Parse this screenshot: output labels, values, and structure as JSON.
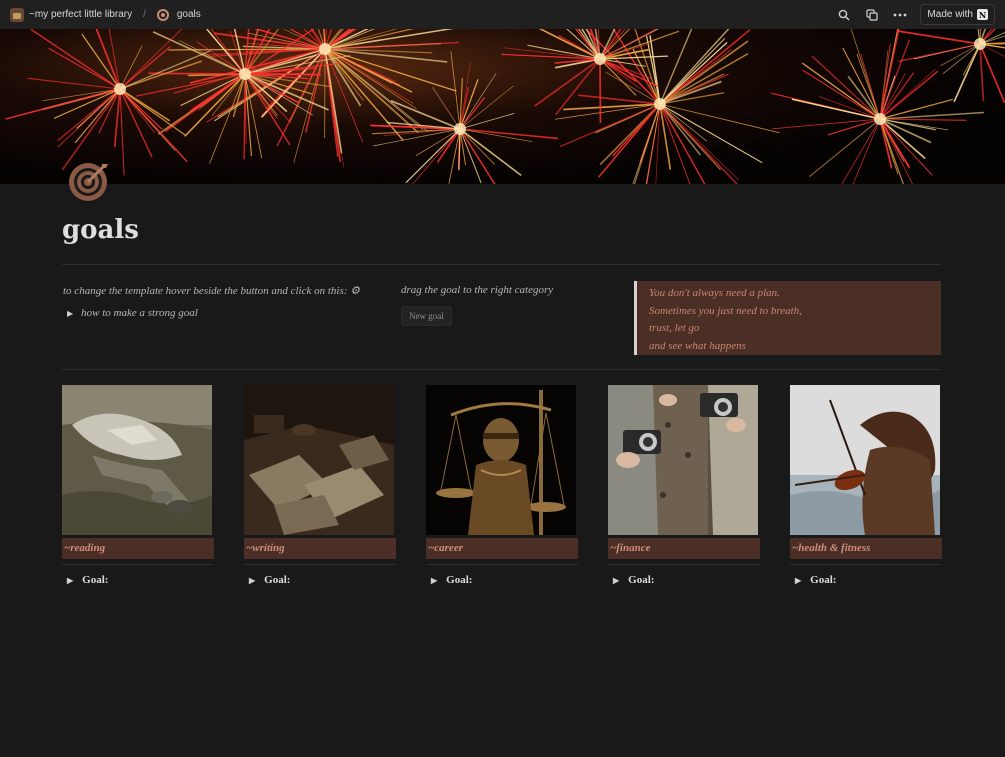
{
  "topbar": {
    "workspace": "~my perfect little library",
    "separator": "/",
    "page": "goals",
    "made_with": "Made with",
    "icons": [
      "search-icon",
      "duplicate-icon",
      "more-icon",
      "notion-logo-icon"
    ]
  },
  "page": {
    "title": "goals",
    "icon": "target-icon"
  },
  "instructions": {
    "template_hint": "to change the template hover beside the button and click on this: ⚙",
    "toggle_strong_goal": "how to make a strong goal",
    "drag_hint": "drag the goal to the right category",
    "new_goal_button": "New goal"
  },
  "quote": {
    "lines": [
      "You don't always need a plan.",
      "Sometimes you just need to breath,",
      "trust, let go",
      "and see what happens"
    ]
  },
  "categories": [
    {
      "label": "~reading",
      "goal": "Goal:"
    },
    {
      "label": "~writing",
      "goal": "Goal:"
    },
    {
      "label": "~career",
      "goal": "Goal:"
    },
    {
      "label": "~finance",
      "goal": "Goal:"
    },
    {
      "label": "~health & fitness",
      "goal": "Goal:"
    }
  ],
  "colors": {
    "background": "#191919",
    "accent_block": "#4b2f27",
    "accent_text": "#cf8e77"
  }
}
